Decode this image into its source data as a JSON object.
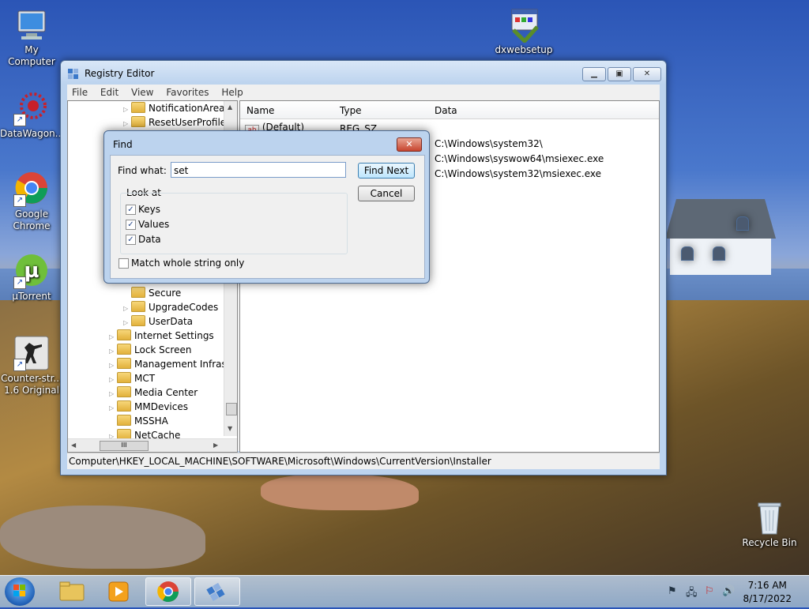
{
  "desktop": {
    "icons": [
      {
        "label": "My Computer"
      },
      {
        "label": "DataWagon..."
      },
      {
        "label": "Google Chrome"
      },
      {
        "label": "μTorrent"
      },
      {
        "label": "Counter-str... 1.6 Original"
      },
      {
        "label": "dxwebsetup"
      },
      {
        "label": "Recycle Bin"
      }
    ]
  },
  "registry": {
    "title": "Registry Editor",
    "menu": [
      "File",
      "Edit",
      "View",
      "Favorites",
      "Help"
    ],
    "tree": [
      "NotificationArea",
      "ResetUserProfile",
      "Secure",
      "UpgradeCodes",
      "UserData",
      "Internet Settings",
      "Lock Screen",
      "Management Infrast",
      "MCT",
      "Media Center",
      "MMDevices",
      "MSSHA",
      "NetCache"
    ],
    "columns": {
      "name": "Name",
      "type": "Type",
      "data": "Data"
    },
    "rows": [
      {
        "name": "(Default)",
        "type": "REG_SZ",
        "data": ""
      },
      {
        "name": "",
        "type": "",
        "data": "C:\\Windows\\system32\\"
      },
      {
        "name": "",
        "type": "",
        "data": "C:\\Windows\\syswow64\\msiexec.exe"
      },
      {
        "name": "",
        "type": "",
        "data": "C:\\Windows\\system32\\msiexec.exe"
      }
    ],
    "hscroll_thumb": "III",
    "status_path": "Computer\\HKEY_LOCAL_MACHINE\\SOFTWARE\\Microsoft\\Windows\\CurrentVersion\\Installer"
  },
  "find": {
    "title": "Find",
    "find_what_label": "Find what:",
    "find_what_value": "set",
    "find_next": "Find Next",
    "cancel": "Cancel",
    "look_at": "Look at",
    "keys": "Keys",
    "values": "Values",
    "data": "Data",
    "match_whole": "Match whole string only",
    "checked": {
      "keys": true,
      "values": true,
      "data": true,
      "match_whole": false
    }
  },
  "taskbar": {
    "time": "7:16 AM",
    "date": "8/17/2022"
  },
  "colors": {
    "accent": "#3c7fb1",
    "title_bg": "#bcd3ee"
  }
}
